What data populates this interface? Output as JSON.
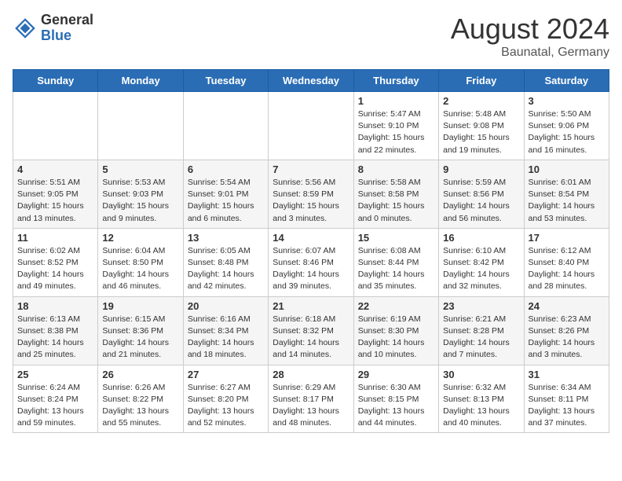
{
  "header": {
    "logo_general": "General",
    "logo_blue": "Blue",
    "month_year": "August 2024",
    "location": "Baunatal, Germany"
  },
  "weekdays": [
    "Sunday",
    "Monday",
    "Tuesday",
    "Wednesday",
    "Thursday",
    "Friday",
    "Saturday"
  ],
  "weeks": [
    [
      {
        "day": "",
        "info": ""
      },
      {
        "day": "",
        "info": ""
      },
      {
        "day": "",
        "info": ""
      },
      {
        "day": "",
        "info": ""
      },
      {
        "day": "1",
        "info": "Sunrise: 5:47 AM\nSunset: 9:10 PM\nDaylight: 15 hours\nand 22 minutes."
      },
      {
        "day": "2",
        "info": "Sunrise: 5:48 AM\nSunset: 9:08 PM\nDaylight: 15 hours\nand 19 minutes."
      },
      {
        "day": "3",
        "info": "Sunrise: 5:50 AM\nSunset: 9:06 PM\nDaylight: 15 hours\nand 16 minutes."
      }
    ],
    [
      {
        "day": "4",
        "info": "Sunrise: 5:51 AM\nSunset: 9:05 PM\nDaylight: 15 hours\nand 13 minutes."
      },
      {
        "day": "5",
        "info": "Sunrise: 5:53 AM\nSunset: 9:03 PM\nDaylight: 15 hours\nand 9 minutes."
      },
      {
        "day": "6",
        "info": "Sunrise: 5:54 AM\nSunset: 9:01 PM\nDaylight: 15 hours\nand 6 minutes."
      },
      {
        "day": "7",
        "info": "Sunrise: 5:56 AM\nSunset: 8:59 PM\nDaylight: 15 hours\nand 3 minutes."
      },
      {
        "day": "8",
        "info": "Sunrise: 5:58 AM\nSunset: 8:58 PM\nDaylight: 15 hours\nand 0 minutes."
      },
      {
        "day": "9",
        "info": "Sunrise: 5:59 AM\nSunset: 8:56 PM\nDaylight: 14 hours\nand 56 minutes."
      },
      {
        "day": "10",
        "info": "Sunrise: 6:01 AM\nSunset: 8:54 PM\nDaylight: 14 hours\nand 53 minutes."
      }
    ],
    [
      {
        "day": "11",
        "info": "Sunrise: 6:02 AM\nSunset: 8:52 PM\nDaylight: 14 hours\nand 49 minutes."
      },
      {
        "day": "12",
        "info": "Sunrise: 6:04 AM\nSunset: 8:50 PM\nDaylight: 14 hours\nand 46 minutes."
      },
      {
        "day": "13",
        "info": "Sunrise: 6:05 AM\nSunset: 8:48 PM\nDaylight: 14 hours\nand 42 minutes."
      },
      {
        "day": "14",
        "info": "Sunrise: 6:07 AM\nSunset: 8:46 PM\nDaylight: 14 hours\nand 39 minutes."
      },
      {
        "day": "15",
        "info": "Sunrise: 6:08 AM\nSunset: 8:44 PM\nDaylight: 14 hours\nand 35 minutes."
      },
      {
        "day": "16",
        "info": "Sunrise: 6:10 AM\nSunset: 8:42 PM\nDaylight: 14 hours\nand 32 minutes."
      },
      {
        "day": "17",
        "info": "Sunrise: 6:12 AM\nSunset: 8:40 PM\nDaylight: 14 hours\nand 28 minutes."
      }
    ],
    [
      {
        "day": "18",
        "info": "Sunrise: 6:13 AM\nSunset: 8:38 PM\nDaylight: 14 hours\nand 25 minutes."
      },
      {
        "day": "19",
        "info": "Sunrise: 6:15 AM\nSunset: 8:36 PM\nDaylight: 14 hours\nand 21 minutes."
      },
      {
        "day": "20",
        "info": "Sunrise: 6:16 AM\nSunset: 8:34 PM\nDaylight: 14 hours\nand 18 minutes."
      },
      {
        "day": "21",
        "info": "Sunrise: 6:18 AM\nSunset: 8:32 PM\nDaylight: 14 hours\nand 14 minutes."
      },
      {
        "day": "22",
        "info": "Sunrise: 6:19 AM\nSunset: 8:30 PM\nDaylight: 14 hours\nand 10 minutes."
      },
      {
        "day": "23",
        "info": "Sunrise: 6:21 AM\nSunset: 8:28 PM\nDaylight: 14 hours\nand 7 minutes."
      },
      {
        "day": "24",
        "info": "Sunrise: 6:23 AM\nSunset: 8:26 PM\nDaylight: 14 hours\nand 3 minutes."
      }
    ],
    [
      {
        "day": "25",
        "info": "Sunrise: 6:24 AM\nSunset: 8:24 PM\nDaylight: 13 hours\nand 59 minutes."
      },
      {
        "day": "26",
        "info": "Sunrise: 6:26 AM\nSunset: 8:22 PM\nDaylight: 13 hours\nand 55 minutes."
      },
      {
        "day": "27",
        "info": "Sunrise: 6:27 AM\nSunset: 8:20 PM\nDaylight: 13 hours\nand 52 minutes."
      },
      {
        "day": "28",
        "info": "Sunrise: 6:29 AM\nSunset: 8:17 PM\nDaylight: 13 hours\nand 48 minutes."
      },
      {
        "day": "29",
        "info": "Sunrise: 6:30 AM\nSunset: 8:15 PM\nDaylight: 13 hours\nand 44 minutes."
      },
      {
        "day": "30",
        "info": "Sunrise: 6:32 AM\nSunset: 8:13 PM\nDaylight: 13 hours\nand 40 minutes."
      },
      {
        "day": "31",
        "info": "Sunrise: 6:34 AM\nSunset: 8:11 PM\nDaylight: 13 hours\nand 37 minutes."
      }
    ]
  ]
}
